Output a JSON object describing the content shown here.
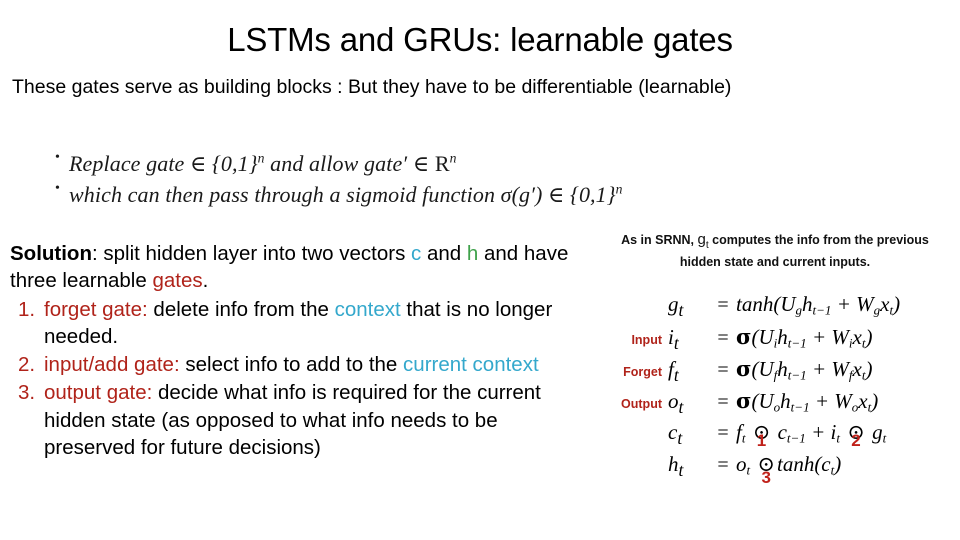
{
  "slide": {
    "title": "LSTMs and GRUs: learnable gates",
    "intro": "These gates serve as building blocks : But they have to be differentiable (learnable)",
    "math_bullets": [
      {
        "id": "bullet-replace-gate",
        "parts": [
          {
            "text": "Replace gate ",
            "style": "italic"
          },
          {
            "text": "∈ {0,1}",
            "style": "italic"
          },
          {
            "text": "n",
            "style": "sup"
          },
          {
            "text": " and allow gate′ ∈ R",
            "style": "italic"
          },
          {
            "text": "n",
            "style": "sup"
          }
        ],
        "plain": "Replace gate ∈ {0,1}n and allow gate′ ∈ Rn"
      },
      {
        "id": "bullet-sigmoid",
        "parts": [
          {
            "text": "which can then pass through a sigmoid function σ(g′) ∈ {0,1}",
            "style": "italic"
          },
          {
            "text": "n",
            "style": "sup"
          }
        ],
        "plain": "which can then pass through a sigmoid function σ(g′) ∈ {0,1}n"
      }
    ]
  },
  "left": {
    "solution_label": "Solution",
    "solution_line1_a": ": split hidden layer into two vectors ",
    "solution_c": "c",
    "solution_and": " and ",
    "solution_h": "h",
    "solution_line2_a": "and have three learnable ",
    "solution_gates": "gates",
    "solution_line2_b": ".",
    "items": [
      {
        "num": "1.",
        "term": "forget gate",
        "sep": ": ",
        "body_a": "delete info from the ",
        "highlight": "context",
        "body_b": " that is no longer needed."
      },
      {
        "num": "2.",
        "term": "input/add gate",
        "sep": ": ",
        "body_a": "select info to add to the ",
        "highlight": "current context",
        "body_b": ""
      },
      {
        "num": "3.",
        "term": "output gate",
        "sep": ": ",
        "body_a": "decide what info is required for the current hidden state (as opposed to what info needs to be preserved for future decisions)",
        "highlight": "",
        "body_b": ""
      }
    ]
  },
  "right": {
    "caption_a": "As in SRNN, ",
    "caption_g": "g",
    "caption_g_sub": "t",
    "caption_b": " computes the info from the previous hidden state and current inputs.",
    "equations": [
      {
        "label": "",
        "lhs": "g",
        "lhs_sub": "t",
        "eq": "=",
        "rhs_plain": "tanh(Uᵍhₜ₋₁ + Wᵍxₜ)"
      },
      {
        "label": "Input",
        "lhs": "i",
        "lhs_sub": "t",
        "eq": "=",
        "rhs_plain": "σ(Uᵢhₜ₋₁ + Wᵢxₜ)"
      },
      {
        "label": "Forget",
        "lhs": "f",
        "lhs_sub": "t",
        "eq": "=",
        "rhs_plain": "σ(Uꜰhₜ₋₁ + Wꜰxₜ)"
      },
      {
        "label": "Output",
        "lhs": "o",
        "lhs_sub": "t",
        "eq": "=",
        "rhs_plain": "σ(Uₒhₜ₋₁ + Wₒxₜ)"
      },
      {
        "label": "",
        "lhs": "c",
        "lhs_sub": "t",
        "eq": "=",
        "rhs_plain": "fₜ ⊙ cₜ₋₁ + iₜ ⊙ gₜ"
      },
      {
        "label": "",
        "lhs": "h",
        "lhs_sub": "t",
        "eq": "=",
        "rhs_plain": "oₜ ⊙ tanh(cₜ)"
      }
    ],
    "markers": [
      "1",
      "2",
      "3"
    ]
  },
  "colors": {
    "red": "#B0231A",
    "cyan": "#34A8CC",
    "green": "#3FA24B",
    "marker_red": "#C0211A",
    "text": "#000000"
  }
}
